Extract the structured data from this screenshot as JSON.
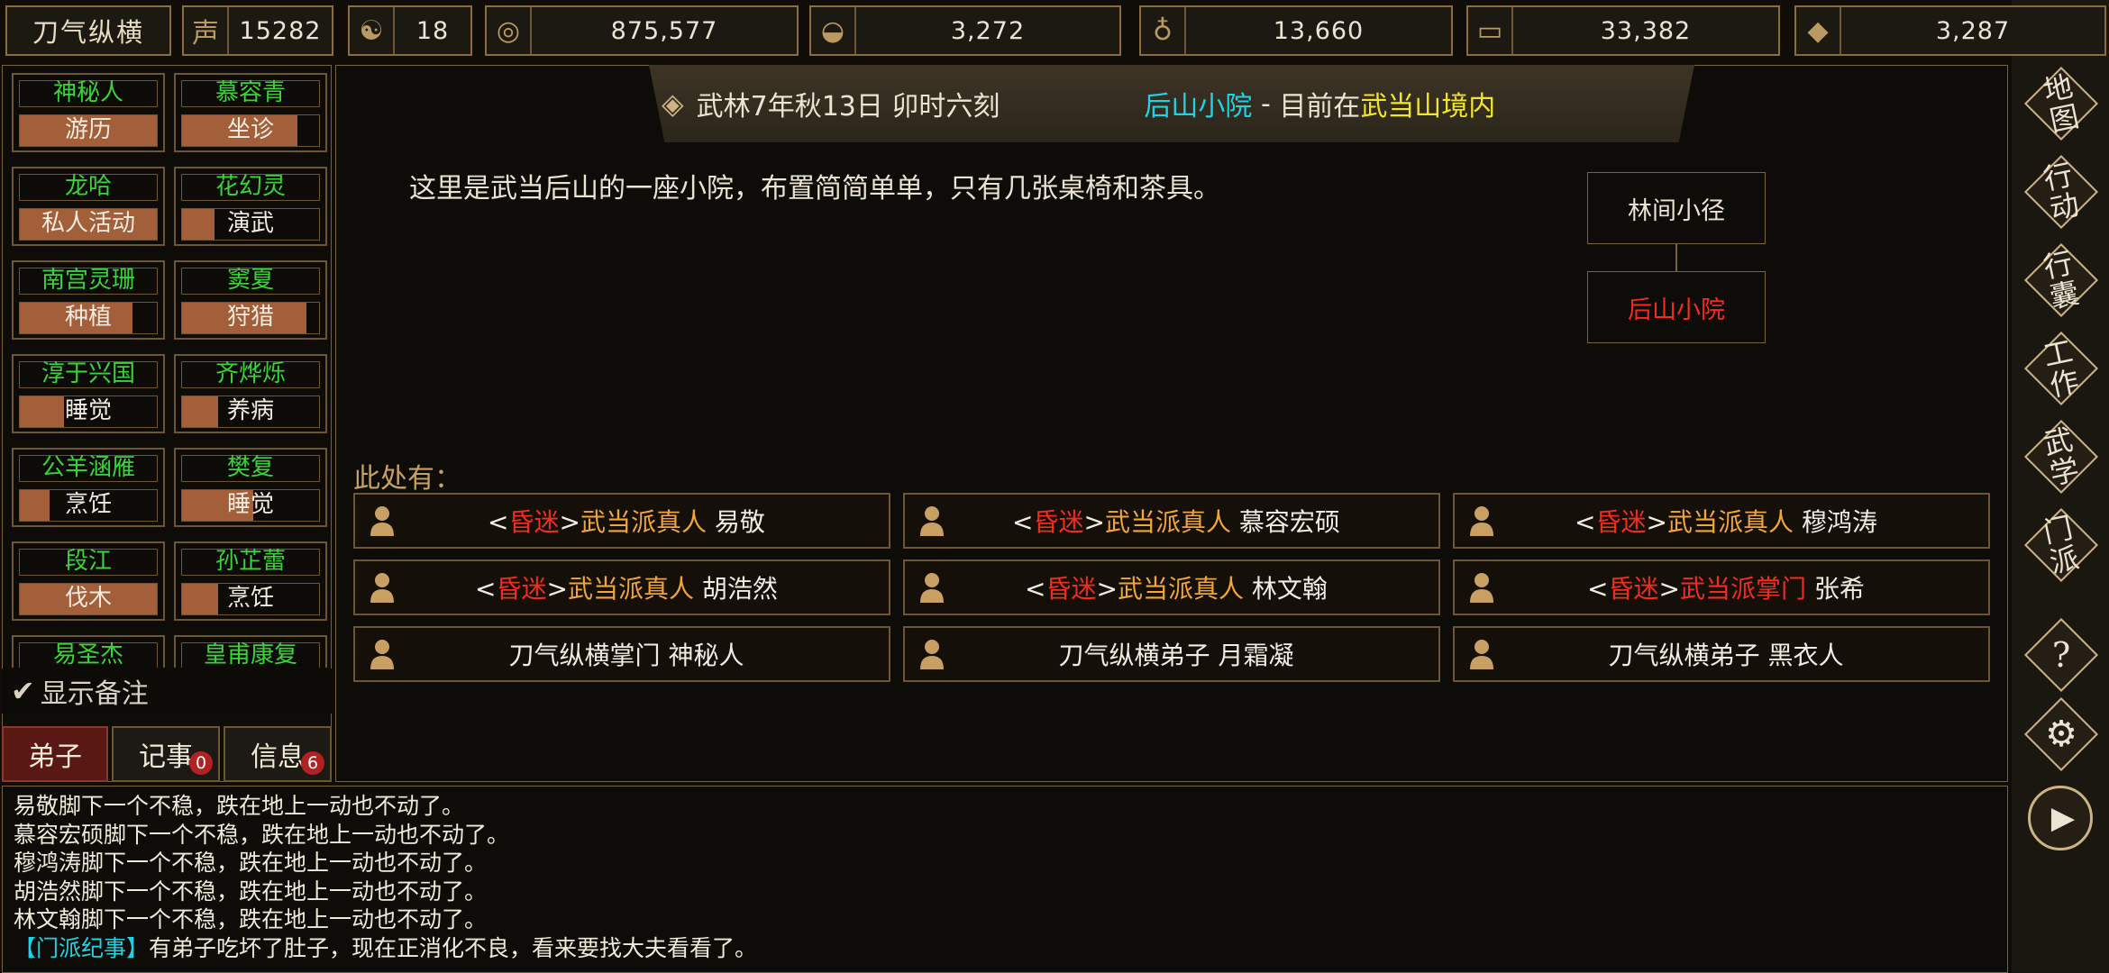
{
  "sect_name": "刀气纵横",
  "resources": [
    {
      "icon": "prestige-icon",
      "value": "15282"
    },
    {
      "icon": "yin-yang-icon",
      "value": "18"
    },
    {
      "icon": "coin-icon",
      "value": "875,577"
    },
    {
      "icon": "food-bowl-icon",
      "value": "3,272"
    },
    {
      "icon": "gourd-icon",
      "value": "13,660"
    },
    {
      "icon": "wood-log-icon",
      "value": "33,382"
    },
    {
      "icon": "ore-icon",
      "value": "3,287"
    }
  ],
  "disciples": [
    {
      "name": "神秘人",
      "activity": "游历",
      "progress": 1.0
    },
    {
      "name": "慕容青",
      "activity": "坐诊",
      "progress": 0.84
    },
    {
      "name": "龙哈",
      "activity": "私人活动",
      "progress": 1.0
    },
    {
      "name": "花幻灵",
      "activity": "演武",
      "progress": 0.24
    },
    {
      "name": "南宫灵珊",
      "activity": "种植",
      "progress": 0.82
    },
    {
      "name": "窦夏",
      "activity": "狩猎",
      "progress": 0.91
    },
    {
      "name": "淳于兴国",
      "activity": "睡觉",
      "progress": 0.32
    },
    {
      "name": "齐烨烁",
      "activity": "养病",
      "progress": 0.26
    },
    {
      "name": "公羊涵雁",
      "activity": "烹饪",
      "progress": 0.22
    },
    {
      "name": "樊复",
      "activity": "睡觉",
      "progress": 0.52
    },
    {
      "name": "段江",
      "activity": "伐木",
      "progress": 1.0
    },
    {
      "name": "孙芷蕾",
      "activity": "烹饪",
      "progress": 0.26
    },
    {
      "name": "易圣杰",
      "activity": "",
      "progress": 0.0
    },
    {
      "name": "皇甫康复",
      "activity": "",
      "progress": 0.0
    }
  ],
  "show_notes": "显示备注",
  "tabs": {
    "disciples": "弟子",
    "events": "记事",
    "events_badge": "0",
    "info": "信息",
    "info_badge": "6"
  },
  "header": {
    "date": "武林7年秋13日 卯时六刻",
    "location": "后山小院",
    "separator": " - ",
    "status": "目前在",
    "region": "武当山境内"
  },
  "description": "这里是武当后山的一座小院，布置简简单单，只有几张桌椅和茶具。",
  "map": {
    "room_north": "林间小径",
    "room_current": "后山小院"
  },
  "here_label": "此处有：",
  "npcs": [
    {
      "status": "昏迷",
      "faction": "武当派真人",
      "name": "易敬"
    },
    {
      "status": "昏迷",
      "faction": "武当派真人",
      "name": "慕容宏硕"
    },
    {
      "status": "昏迷",
      "faction": "武当派真人",
      "name": "穆鸿涛"
    },
    {
      "status": "昏迷",
      "faction": "武当派真人",
      "name": "胡浩然"
    },
    {
      "status": "昏迷",
      "faction": "武当派真人",
      "name": "林文翰"
    },
    {
      "status": "昏迷",
      "faction": "武当派掌门",
      "name": "张希"
    },
    {
      "status": "",
      "faction": "刀气纵横掌门",
      "name": "神秘人"
    },
    {
      "status": "",
      "faction": "刀气纵横弟子",
      "name": "月霜凝"
    },
    {
      "status": "",
      "faction": "刀气纵横弟子",
      "name": "黑衣人"
    }
  ],
  "log": [
    "易敬脚下一个不稳，跌在地上一动也不动了。",
    "慕容宏硕脚下一个不稳，跌在地上一动也不动了。",
    "穆鸿涛脚下一个不稳，跌在地上一动也不动了。",
    "胡浩然脚下一个不稳，跌在地上一动也不动了。",
    "林文翰脚下一个不稳，跌在地上一动也不动了。"
  ],
  "log_news": {
    "tag": "【门派纪事】",
    "text": "有弟子吃坏了肚子，现在正消化不良，看来要找大夫看看了。"
  },
  "menu": [
    "地图",
    "行动",
    "行囊",
    "工作",
    "武学",
    "门派"
  ],
  "menu_extra": {
    "help": "?"
  },
  "colors": {
    "gold": "#8a6d3b",
    "npc_status": "#f22c1e",
    "npc_faction": "#f2a63a",
    "location": "#1fd3e6",
    "region": "#f3e629",
    "disciple_name": "#39d437"
  }
}
